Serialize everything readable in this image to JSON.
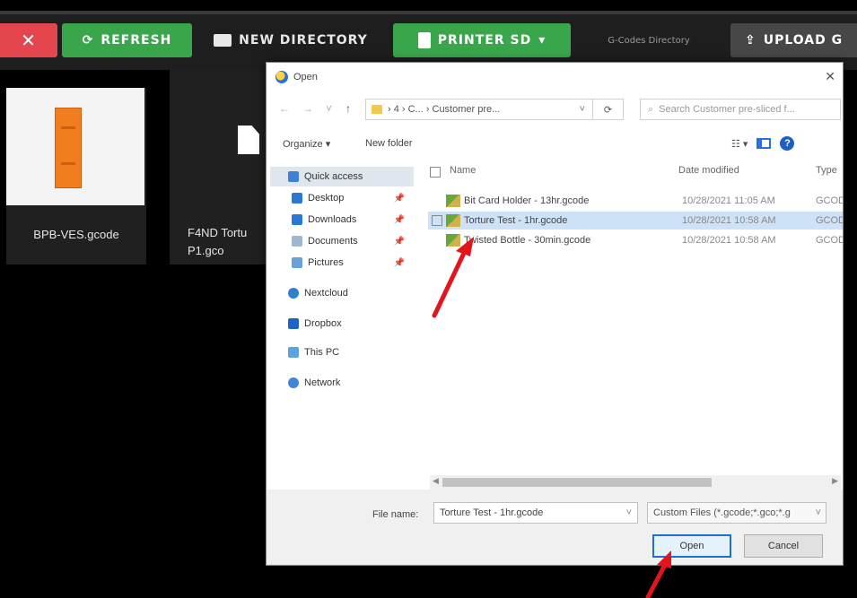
{
  "toolbar": {
    "close_glyph": "✕",
    "refresh_label": "REFRESH",
    "new_directory_label": "NEW DIRECTORY",
    "printer_sd_label": "PRINTER SD",
    "printer_sd_caret": "▾",
    "gcodes_directory_label": "G-Codes Directory",
    "upload_label": "UPLOAD G"
  },
  "tiles": [
    {
      "name": "BPB-VES.gcode"
    },
    {
      "name": "F4ND Tortu P1.gco"
    }
  ],
  "dialog": {
    "title": "Open",
    "close_glyph": "✕",
    "breadcrumb": "› 4 › C... › Customer pre...",
    "search_placeholder": "Search Customer pre-sliced f...",
    "organize_label": "Organize ▾",
    "new_folder_label": "New folder",
    "nav_items": [
      {
        "label": "Quick access",
        "icon": "star-icon",
        "pinned": false,
        "selected": true
      },
      {
        "label": "Desktop",
        "icon": "desktop-icon",
        "pinned": true,
        "selected": false
      },
      {
        "label": "Downloads",
        "icon": "download-icon",
        "pinned": true,
        "selected": false
      },
      {
        "label": "Documents",
        "icon": "documents-icon",
        "pinned": true,
        "selected": false
      },
      {
        "label": "Pictures",
        "icon": "pictures-icon",
        "pinned": true,
        "selected": false
      },
      {
        "label": "Nextcloud",
        "icon": "cloud-icon",
        "pinned": false,
        "selected": false
      },
      {
        "label": "Dropbox",
        "icon": "dropbox-icon",
        "pinned": false,
        "selected": false
      },
      {
        "label": "This PC",
        "icon": "computer-icon",
        "pinned": false,
        "selected": false
      },
      {
        "label": "Network",
        "icon": "network-icon",
        "pinned": false,
        "selected": false
      }
    ],
    "columns": {
      "name": "Name",
      "date": "Date modified",
      "type": "Type"
    },
    "files": [
      {
        "name": "Bit Card Holder - 13hr.gcode",
        "date": "10/28/2021 11:05 AM",
        "type": "GCOD",
        "selected": false
      },
      {
        "name": "Torture Test - 1hr.gcode",
        "date": "10/28/2021 10:58 AM",
        "type": "GCOD",
        "selected": true
      },
      {
        "name": "Twisted Bottle - 30min.gcode",
        "date": "10/28/2021 10:58 AM",
        "type": "GCOD",
        "selected": false
      }
    ],
    "file_name_label": "File name:",
    "file_name_value": "Torture Test - 1hr.gcode",
    "file_type_filter": "Custom Files (*.gcode;*.gco;*.g",
    "open_label": "Open",
    "cancel_label": "Cancel"
  },
  "colors": {
    "green": "#3aa64c",
    "red": "#e5454c",
    "arrow": "#e3141b",
    "accent_blue": "#1f6fd0"
  }
}
